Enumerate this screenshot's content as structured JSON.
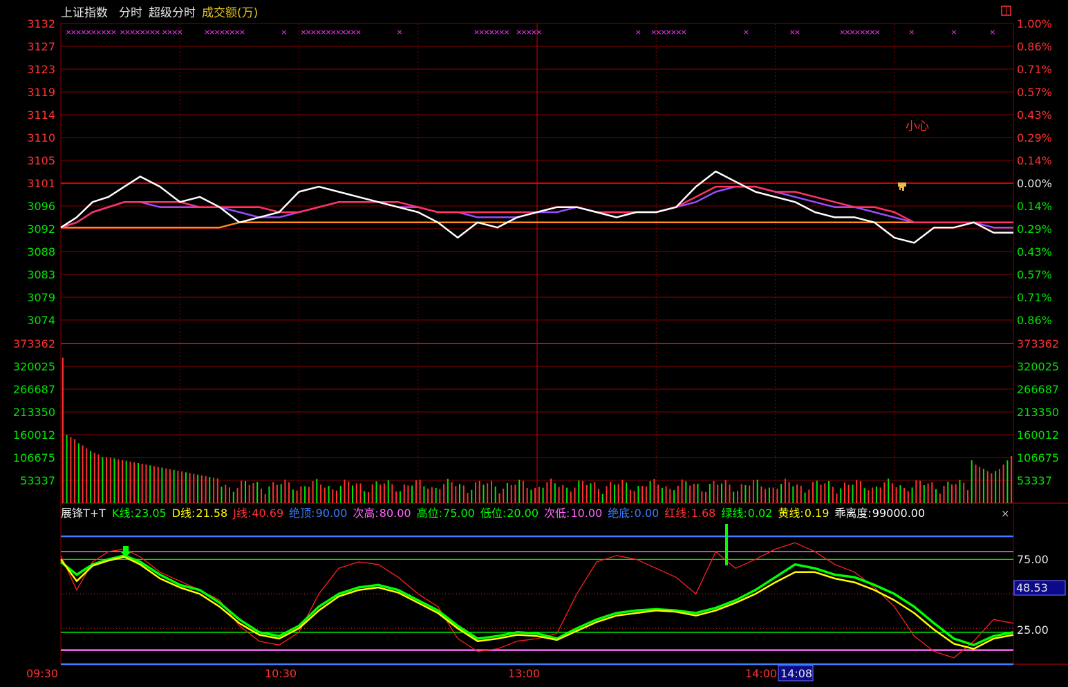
{
  "header": {
    "title": "上证指数",
    "mode1": "分时",
    "mode2": "超级分时",
    "volume_label": "成交额(万)"
  },
  "colors": {
    "bg": "#000000",
    "grid": "#8a0000",
    "up": "#ff3232",
    "down": "#00e600",
    "price_line": "#ffffff",
    "avg_line": "#ff3366",
    "ma_line": "#9a4dff",
    "base_line": "#ff8c1a",
    "marker": "#ff33ff"
  },
  "annotation": "小心",
  "time_labels": [
    "09:30",
    "10:30",
    "13:00",
    "14:00"
  ],
  "time_cursor": "14:08",
  "price_ticks": [
    "3132",
    "3127",
    "3123",
    "3119",
    "3114",
    "3110",
    "3105",
    "3101",
    "3096",
    "3092",
    "3088",
    "3083",
    "3079",
    "3074"
  ],
  "pct_ticks": [
    "1.00%",
    "0.86%",
    "0.71%",
    "0.57%",
    "0.43%",
    "0.29%",
    "0.14%",
    "0.00%",
    "0.14%",
    "0.29%",
    "0.43%",
    "0.57%",
    "0.71%",
    "0.86%"
  ],
  "volume_ticks": [
    "373362",
    "320025",
    "266687",
    "213350",
    "160012",
    "106675",
    "53337"
  ],
  "indicator": {
    "name": "展锋T+T",
    "items": [
      {
        "label": "K线:",
        "value": "23.05",
        "color": "#00ff00"
      },
      {
        "label": "D线:",
        "value": "21.58",
        "color": "#ffff00"
      },
      {
        "label": "J线:",
        "value": "40.69",
        "color": "#ff3232"
      },
      {
        "label": "绝顶:",
        "value": "90.00",
        "color": "#3d7fff"
      },
      {
        "label": "次高:",
        "value": "80.00",
        "color": "#ff66ff"
      },
      {
        "label": "高位:",
        "value": "75.00",
        "color": "#00ff00"
      },
      {
        "label": "低位:",
        "value": "20.00",
        "color": "#00ff00"
      },
      {
        "label": "次低:",
        "value": "10.00",
        "color": "#ff66ff"
      },
      {
        "label": "绝底:",
        "value": "0.00",
        "color": "#3d7fff"
      },
      {
        "label": "红线:",
        "value": "1.68",
        "color": "#ff3232"
      },
      {
        "label": "绿线:",
        "value": "0.02",
        "color": "#00ff00"
      },
      {
        "label": "黄线:",
        "value": "0.19",
        "color": "#ffff00"
      },
      {
        "label": "乖离度:",
        "value": "99000.00",
        "color": "#ffffff"
      }
    ],
    "close": "×",
    "ticks": [
      "75.00",
      "25.00"
    ],
    "cursor_value": "48.53"
  },
  "chart_data": [
    {
      "type": "line",
      "y_range": [
        3074,
        3132
      ],
      "prev_close": 3101,
      "x": [
        0,
        4,
        8,
        12,
        16,
        20,
        25,
        30,
        35,
        40,
        45,
        50,
        55,
        60,
        65,
        70,
        75,
        80,
        85,
        90,
        95,
        100,
        105,
        110,
        115,
        120,
        125,
        130,
        135,
        140,
        145,
        150,
        155,
        160,
        165,
        170,
        175,
        180,
        185,
        190,
        195,
        200,
        205,
        210,
        215,
        220,
        225,
        230,
        235,
        240
      ],
      "series": [
        {
          "key": "price",
          "values": [
            3092,
            3094,
            3097,
            3098,
            3100,
            3102,
            3100,
            3097,
            3098,
            3096,
            3093,
            3094,
            3095,
            3099,
            3100,
            3099,
            3098,
            3097,
            3096,
            3095,
            3093,
            3090,
            3093,
            3092,
            3094,
            3095,
            3096,
            3096,
            3095,
            3094,
            3095,
            3095,
            3096,
            3100,
            3103,
            3101,
            3099,
            3098,
            3097,
            3095,
            3094,
            3094,
            3093,
            3090,
            3089,
            3092,
            3092,
            3093,
            3091,
            3091
          ]
        },
        {
          "key": "avg",
          "values": [
            3092,
            3093,
            3095,
            3096,
            3097,
            3097,
            3097,
            3097,
            3096,
            3096,
            3096,
            3096,
            3095,
            3095,
            3096,
            3097,
            3097,
            3097,
            3097,
            3096,
            3095,
            3095,
            3095,
            3095,
            3095,
            3095,
            3096,
            3096,
            3095,
            3095,
            3095,
            3095,
            3096,
            3098,
            3100,
            3100,
            3100,
            3099,
            3099,
            3098,
            3097,
            3096,
            3096,
            3095,
            3093,
            3093,
            3093,
            3093,
            3093,
            3093
          ]
        },
        {
          "key": "ma",
          "values": [
            3092,
            3093,
            3095,
            3096,
            3097,
            3097,
            3096,
            3096,
            3096,
            3096,
            3095,
            3094,
            3094,
            3095,
            3096,
            3097,
            3097,
            3097,
            3096,
            3096,
            3095,
            3095,
            3094,
            3094,
            3094,
            3095,
            3095,
            3096,
            3095,
            3095,
            3095,
            3095,
            3096,
            3097,
            3099,
            3100,
            3100,
            3099,
            3098,
            3097,
            3096,
            3096,
            3095,
            3094,
            3093,
            3093,
            3093,
            3093,
            3092,
            3092
          ]
        },
        {
          "key": "base",
          "values": [
            3092,
            3092,
            3092,
            3092,
            3092,
            3092,
            3092,
            3092,
            3092,
            3092,
            3093,
            3093,
            3093,
            3093,
            3093,
            3093,
            3093,
            3093,
            3093,
            3093,
            3093,
            3093,
            3093,
            3093,
            3093,
            3093,
            3093,
            3093,
            3093,
            3093,
            3093,
            3093,
            3093,
            3093,
            3093,
            3093,
            3093,
            3093,
            3093,
            3093,
            3093,
            3093,
            3093,
            3093,
            3093,
            3093,
            3093,
            3093,
            3093,
            3093
          ]
        }
      ]
    },
    {
      "type": "bar",
      "y_range": [
        0,
        373362
      ],
      "x_range": [
        0,
        240
      ],
      "values_up_down": "alternating",
      "first_value": 340000,
      "early_values": [
        160000,
        155000,
        150000,
        140000,
        135000,
        128000,
        122000,
        118000,
        114000,
        108000
      ],
      "typical_value": 50000,
      "late_values": [
        100000,
        90000,
        85000,
        80000,
        75000,
        70000,
        75000,
        80000,
        90000,
        100000,
        110000
      ]
    },
    {
      "type": "line",
      "y_range": [
        0,
        100
      ],
      "x": [
        0,
        4,
        8,
        12,
        16,
        20,
        25,
        30,
        35,
        40,
        45,
        50,
        55,
        60,
        65,
        70,
        75,
        80,
        85,
        90,
        95,
        100,
        105,
        110,
        115,
        120,
        125,
        130,
        135,
        140,
        145,
        150,
        155,
        160,
        165,
        170,
        175,
        180,
        185,
        190,
        195,
        200,
        205,
        210,
        215,
        220,
        225,
        230,
        235,
        240
      ],
      "series": [
        {
          "key": "K",
          "values": [
            80,
            70,
            78,
            82,
            85,
            80,
            70,
            62,
            58,
            48,
            35,
            25,
            22,
            30,
            45,
            55,
            60,
            62,
            58,
            50,
            42,
            30,
            20,
            22,
            25,
            24,
            20,
            28,
            35,
            40,
            42,
            43,
            42,
            40,
            44,
            50,
            58,
            68,
            78,
            75,
            70,
            68,
            62,
            55,
            45,
            32,
            20,
            15,
            22,
            25
          ]
        },
        {
          "key": "D",
          "values": [
            82,
            65,
            77,
            81,
            84,
            78,
            67,
            60,
            55,
            45,
            32,
            23,
            20,
            28,
            42,
            53,
            58,
            60,
            56,
            48,
            40,
            28,
            18,
            20,
            23,
            22,
            19,
            26,
            33,
            38,
            40,
            42,
            41,
            38,
            42,
            48,
            55,
            64,
            72,
            72,
            67,
            64,
            58,
            50,
            40,
            27,
            16,
            12,
            20,
            23
          ]
        },
        {
          "key": "J",
          "values": [
            85,
            58,
            80,
            88,
            90,
            84,
            72,
            65,
            58,
            50,
            30,
            18,
            15,
            25,
            55,
            75,
            80,
            78,
            68,
            55,
            45,
            20,
            10,
            12,
            18,
            20,
            24,
            55,
            80,
            85,
            82,
            75,
            68,
            55,
            88,
            75,
            82,
            90,
            95,
            88,
            78,
            72,
            60,
            45,
            22,
            10,
            5,
            18,
            35,
            32
          ]
        }
      ]
    }
  ]
}
